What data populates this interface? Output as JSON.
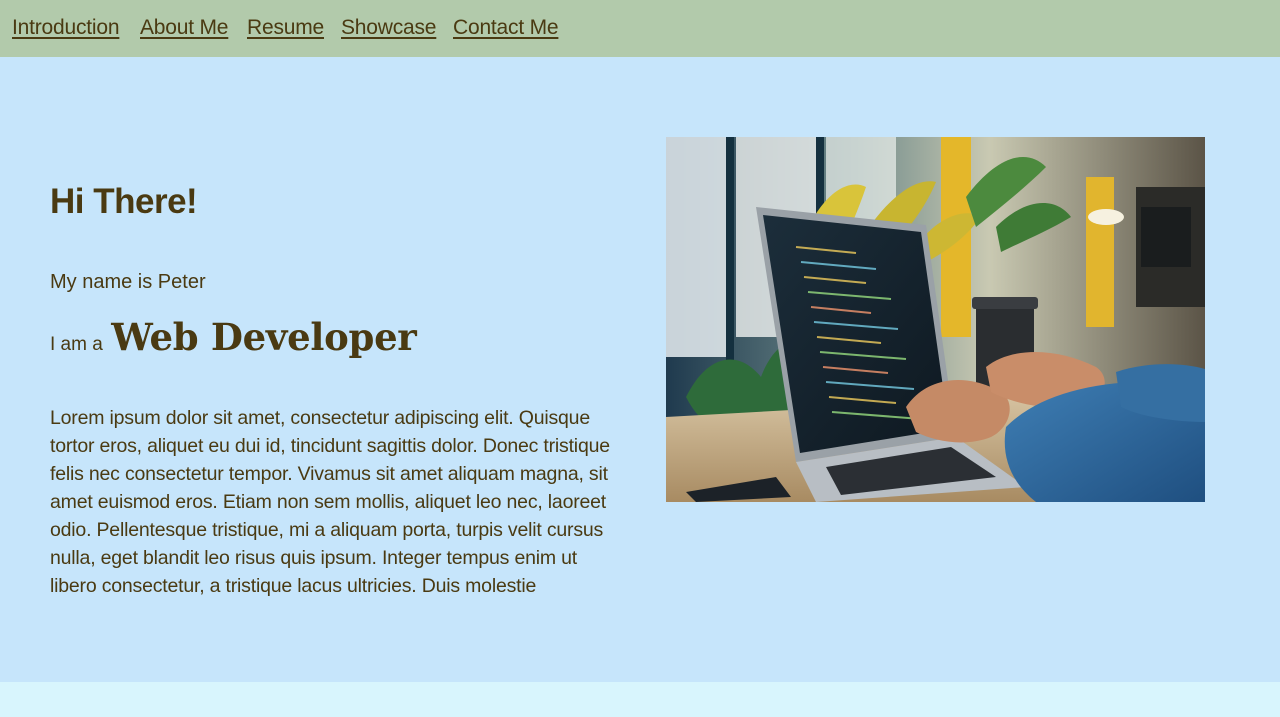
{
  "nav": {
    "items": [
      {
        "label": "Introduction"
      },
      {
        "label": "About Me"
      },
      {
        "label": "Resume"
      },
      {
        "label": "Showcase"
      },
      {
        "label": "Contact Me"
      }
    ]
  },
  "hero": {
    "greeting": "Hi There!",
    "name_line": "My name is Peter",
    "role_prefix": "I am a",
    "role_title": "Web Developer",
    "bio": "Lorem ipsum dolor sit amet, consectetur adipiscing elit. Quisque tortor eros, aliquet eu dui id, tincidunt sagittis dolor. Donec tristique felis nec consectetur tempor. Vivamus sit amet aliquam magna, sit amet euismod eros. Etiam non sem mollis, aliquet leo nec, laoreet odio. Pellentesque tristique, mi a aliquam porta, turpis velit cursus nulla, eget blandit leo risus quis ipsum. Integer tempus enim ut libero consectetur, a tristique lacus ultricies. Duis molestie"
  },
  "colors": {
    "nav_background": "#b2caab",
    "hero_background": "#c6e5fb",
    "footer_background": "#d8f5fd",
    "text": "#4a3a12"
  }
}
